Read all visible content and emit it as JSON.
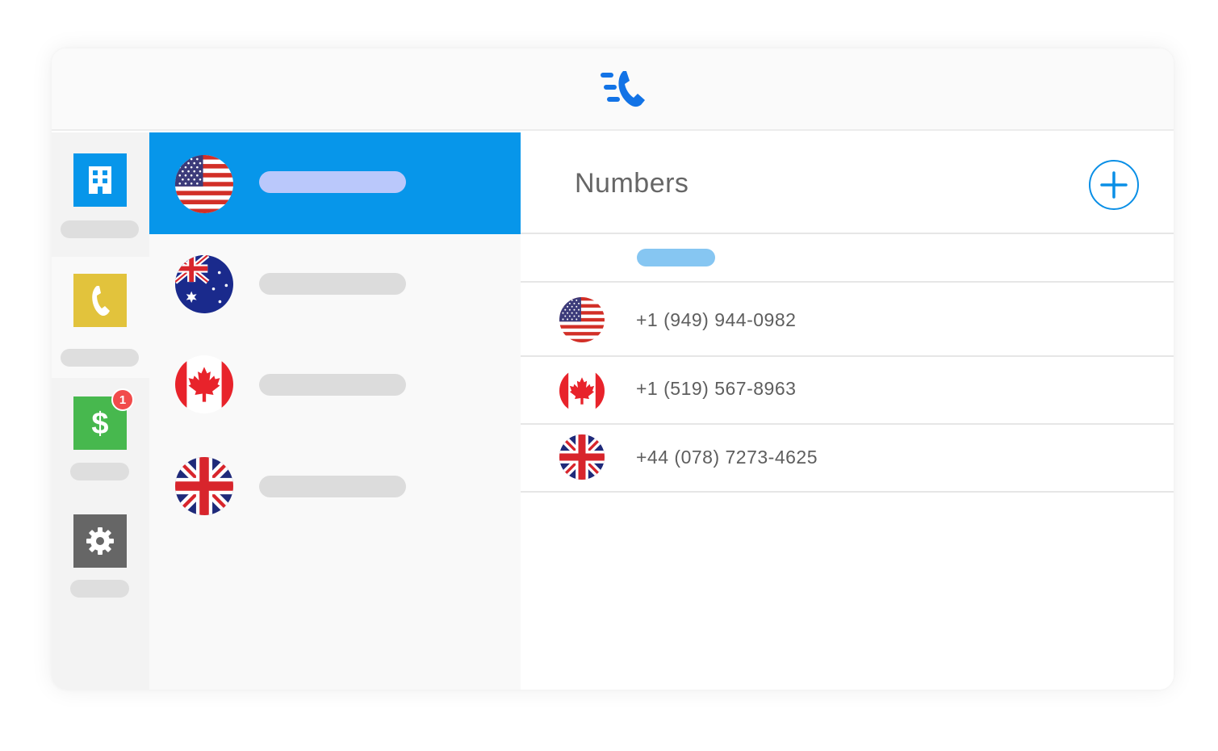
{
  "header": {
    "logo_icon": "phone-lines-logo-icon",
    "brand_color": "#1273e6"
  },
  "rail": {
    "items": [
      {
        "icon": "building-icon",
        "color": "#0796ea",
        "active": false
      },
      {
        "icon": "phone-icon",
        "color": "#e2c33c",
        "active": true
      },
      {
        "icon": "dollar-icon",
        "color": "#47b84e",
        "active": false,
        "badge": "1"
      },
      {
        "icon": "gear-icon",
        "color": "#666666",
        "active": false
      }
    ]
  },
  "countries": {
    "selected_index": 0,
    "items": [
      {
        "flag": "us-flag-icon"
      },
      {
        "flag": "au-flag-icon"
      },
      {
        "flag": "ca-flag-icon"
      },
      {
        "flag": "uk-flag-icon"
      }
    ]
  },
  "numbers_panel": {
    "title": "Numbers",
    "add_icon": "plus-icon",
    "accent_color": "#0a8fe6",
    "rows": [
      {
        "flag": "us-flag-icon",
        "number": "+1 (949) 944-0982"
      },
      {
        "flag": "ca-flag-icon",
        "number": "+1 (519) 567-8963"
      },
      {
        "flag": "uk-flag-icon",
        "number": "+44 (078) 7273-4625"
      }
    ]
  }
}
